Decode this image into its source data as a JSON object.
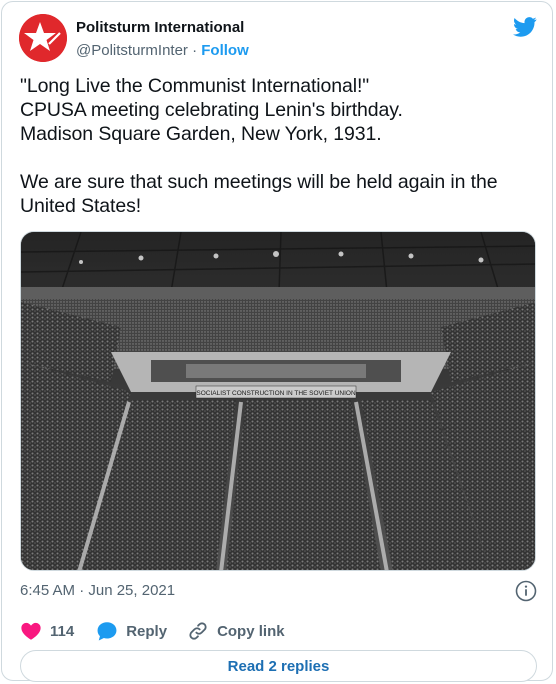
{
  "author": {
    "display_name": "Politsturm International",
    "handle": "@PolitsturmInter",
    "separator": "·",
    "follow_label": "Follow",
    "avatar_color": "#e0282c"
  },
  "tweet": {
    "lines": [
      "\"Long Live the Communist International!\"",
      "CPUSA meeting celebrating Lenin's birthday.",
      "Madison Square Garden, New York, 1931.",
      "",
      "We are sure that such meetings will be held again in the",
      "United States!"
    ],
    "photo_banner_text": "SOCIALIST CONSTRUCTION IN THE SOVIET UNION",
    "timestamp": "6:45 AM · Jun 25, 2021"
  },
  "actions": {
    "likes_count": "114",
    "reply_label": "Reply",
    "copy_link_label": "Copy link"
  },
  "footer": {
    "read_replies_label": "Read 2 replies"
  },
  "colors": {
    "twitter_blue": "#1d9bf0",
    "like_pink": "#f91880",
    "text_primary": "#0f1419",
    "text_secondary": "#536471"
  },
  "icons": [
    "twitter-bird-icon",
    "info-icon",
    "heart-icon",
    "reply-bubble-icon",
    "link-icon",
    "star-logo-icon"
  ]
}
